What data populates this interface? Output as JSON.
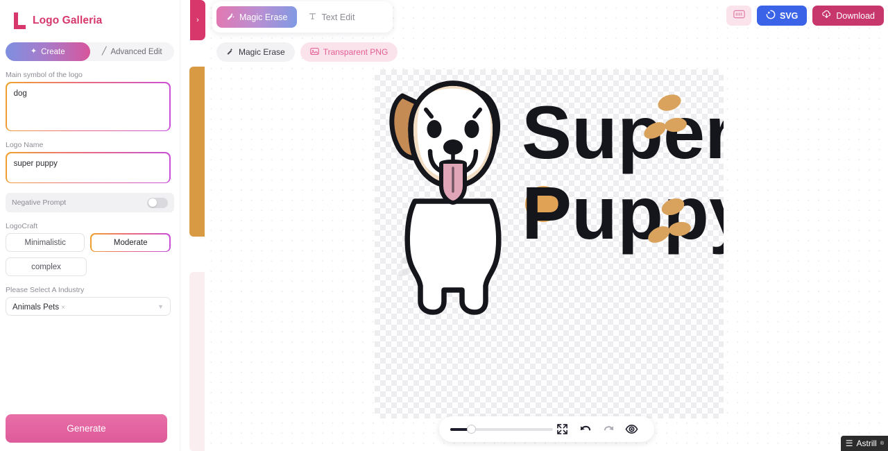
{
  "brand": {
    "name": "Logo Galleria",
    "logo_mark": "L",
    "accent": "#d7376b"
  },
  "sidebar": {
    "segmented": [
      {
        "label": "Create",
        "icon": "sparkle-icon",
        "active": true
      },
      {
        "label": "Advanced Edit",
        "icon": "wand-icon",
        "active": false
      }
    ],
    "main_symbol": {
      "label": "Main symbol of the logo",
      "value": "dog"
    },
    "logo_name": {
      "label": "Logo Name",
      "value": "super puppy"
    },
    "negative_prompt": {
      "label": "Negative Prompt",
      "enabled": false
    },
    "logocraft": {
      "label": "LogoCraft",
      "options": [
        {
          "label": "Minimalistic",
          "selected": false
        },
        {
          "label": "Moderate",
          "selected": true
        },
        {
          "label": "complex",
          "selected": false
        }
      ]
    },
    "industry": {
      "label": "Please Select A Industry",
      "value": "Animals Pets",
      "clear": "×",
      "chevron": "⌄"
    },
    "generate": {
      "label": "Generate"
    }
  },
  "panel_strip": {
    "collapse_chevron": "›",
    "panels": [
      "orange-panel",
      "pink-panel"
    ]
  },
  "canvas": {
    "tabs": [
      {
        "label": "Magic Erase",
        "icon": "magic-wand-icon",
        "active": true
      },
      {
        "label": "Text Edit",
        "icon": "text-cursor-icon",
        "active": false
      }
    ],
    "pills": [
      {
        "label": "Magic Erase",
        "icon": "magic-wand-icon",
        "style": "grey"
      },
      {
        "label": "Transparent PNG",
        "icon": "image-icon",
        "style": "pink"
      }
    ],
    "actions": {
      "keyboard_button": "keyboard-icon",
      "svg": {
        "label": "SVG",
        "icon": "svg-badge-icon",
        "color": "#3b63e8"
      },
      "download": {
        "label": "Download",
        "icon": "cloud-download-icon",
        "color": "#c8376b"
      }
    },
    "artwork": {
      "title_line_1": "Super",
      "title_line_2": "Puppy",
      "subject": "cartoon-dog",
      "colors": {
        "text": "#15151c",
        "ear_tan": "#c58b54",
        "fur_cream": "#f2dec4",
        "body_white": "#ffffff",
        "tongue": "#e0a6b8",
        "paw_tan": "#d9a35e",
        "accent_orange": "#e0a355"
      }
    },
    "bottom_bar": {
      "zoom_slider": {
        "value": 20,
        "min": 0,
        "max": 100
      },
      "buttons": [
        {
          "name": "fit-screen-icon",
          "label": "fit"
        },
        {
          "name": "undo-icon",
          "label": "undo"
        },
        {
          "name": "redo-icon",
          "label": "redo"
        },
        {
          "name": "preview-eye-icon",
          "label": "preview"
        }
      ]
    }
  },
  "overlay": {
    "astrill_label": "Astrill",
    "astrill_menu": "☰",
    "astrill_reg": "®"
  }
}
